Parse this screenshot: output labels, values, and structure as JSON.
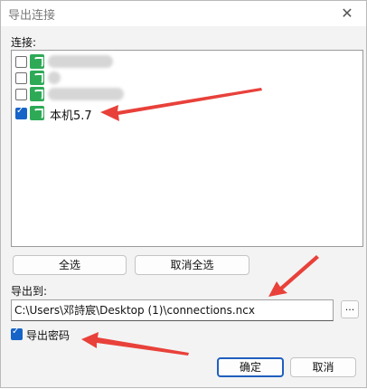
{
  "window": {
    "title": "导出连接",
    "close_glyph": "✕"
  },
  "connections_label": "连接:",
  "connections": [
    {
      "label": "",
      "checked": false
    },
    {
      "label": "",
      "checked": false
    },
    {
      "label": "",
      "checked": false
    },
    {
      "label": "本机5.7",
      "checked": true
    }
  ],
  "buttons": {
    "select_all": "全选",
    "deselect_all": "取消全选",
    "ok": "确定",
    "cancel": "取消",
    "browse": "..."
  },
  "export_to_label": "导出到:",
  "export_path": "C:\\Users\\邓詩宸\\Desktop (1)\\connections.ncx",
  "export_password": {
    "label": "导出密码",
    "checked": true
  },
  "colors": {
    "accent": "#1664c8",
    "icon": "#2eaa57",
    "arrow": "#e8413a"
  }
}
